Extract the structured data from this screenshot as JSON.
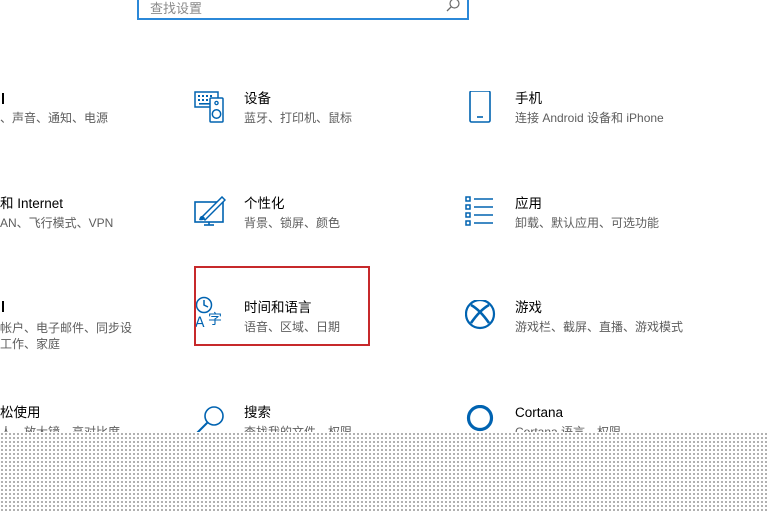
{
  "search": {
    "placeholder": "查找设置"
  },
  "left_tiles": [
    {
      "title": "",
      "desc1": "、声音、通知、电源",
      "desc2": ""
    },
    {
      "title": "和 Internet",
      "desc1": "AN、飞行模式、VPN",
      "desc2": ""
    },
    {
      "title": "",
      "desc1": "帐户、电子邮件、同步设",
      "desc2": "工作、家庭"
    },
    {
      "title": "松使用",
      "desc1": "人、放大镜、高对比度",
      "desc2": ""
    }
  ],
  "tiles": {
    "devices": {
      "title": "设备",
      "desc": "蓝牙、打印机、鼠标",
      "icon": "keyboard-speaker-icon"
    },
    "phone": {
      "title": "手机",
      "desc": "连接 Android 设备和 iPhone",
      "icon": "phone-icon"
    },
    "personal": {
      "title": "个性化",
      "desc": "背景、锁屏、颜色",
      "icon": "paint-monitor-icon"
    },
    "apps": {
      "title": "应用",
      "desc": "卸载、默认应用、可选功能",
      "icon": "apps-list-icon"
    },
    "time": {
      "title": "时间和语言",
      "desc": "语音、区域、日期",
      "icon": "time-language-icon"
    },
    "gaming": {
      "title": "游戏",
      "desc": "游戏栏、截屏、直播、游戏模式",
      "icon": "xbox-icon"
    },
    "search": {
      "title": "搜索",
      "desc": "查找我的文件、权限",
      "icon": "search-icon"
    },
    "cortana": {
      "title": "Cortana",
      "desc": "Cortana 语言、权限",
      "icon": "cortana-ring-icon"
    }
  },
  "colors": {
    "accent": "#0063b1",
    "highlight": "#c7292b"
  }
}
